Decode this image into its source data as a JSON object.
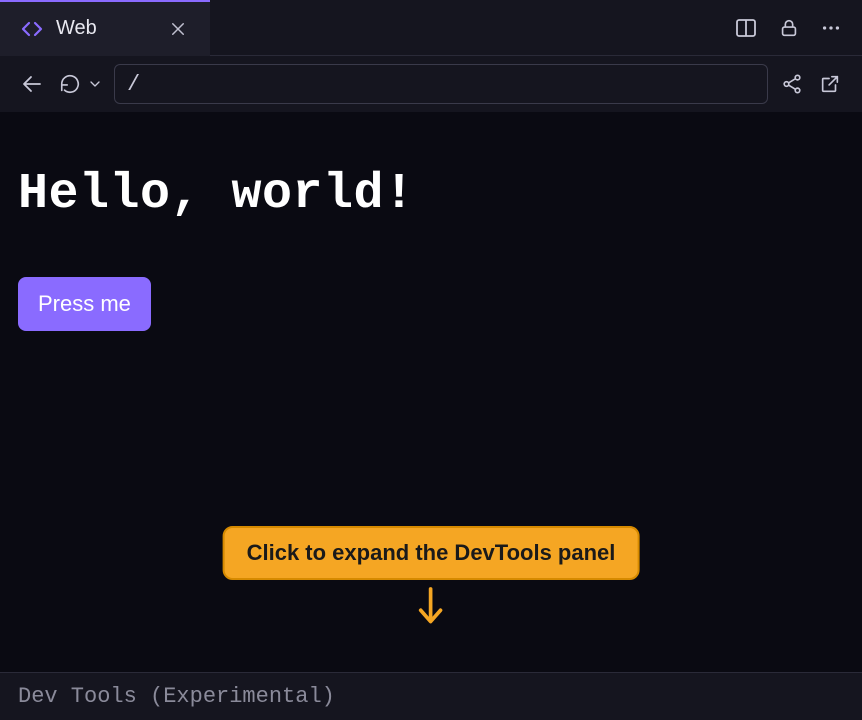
{
  "tab": {
    "label": "Web"
  },
  "url": {
    "value": "/"
  },
  "page": {
    "heading": "Hello, world!",
    "button_label": "Press me"
  },
  "callout": {
    "text": "Click to expand the DevTools panel"
  },
  "devtools": {
    "label": "Dev Tools (Experimental)"
  }
}
